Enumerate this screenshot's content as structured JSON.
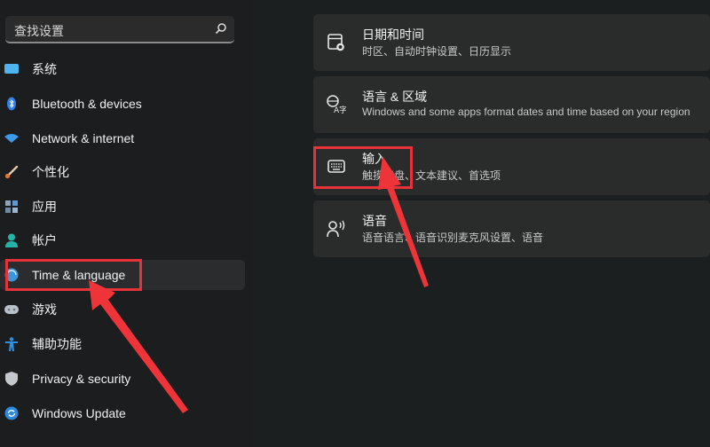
{
  "search": {
    "placeholder": "查找设置",
    "icon": "search-icon"
  },
  "sidebar": {
    "items": [
      {
        "label": "系统",
        "icon": "monitor-icon",
        "selected": false
      },
      {
        "label": "Bluetooth & devices",
        "icon": "bluetooth-icon",
        "selected": false
      },
      {
        "label": "Network & internet",
        "icon": "wifi-icon",
        "selected": false
      },
      {
        "label": "个性化",
        "icon": "paintbrush-icon",
        "selected": false
      },
      {
        "label": "应用",
        "icon": "apps-icon",
        "selected": false
      },
      {
        "label": "帐户",
        "icon": "person-icon",
        "selected": false
      },
      {
        "label": "Time & language",
        "icon": "globe-clock-icon",
        "selected": true
      },
      {
        "label": "游戏",
        "icon": "gamepad-icon",
        "selected": false
      },
      {
        "label": "辅助功能",
        "icon": "accessibility-icon",
        "selected": false
      },
      {
        "label": "Privacy & security",
        "icon": "shield-icon",
        "selected": false
      },
      {
        "label": "Windows Update",
        "icon": "update-icon",
        "selected": false
      }
    ]
  },
  "main": {
    "cards": [
      {
        "title": "日期和时间",
        "subtitle": "时区、自动时钟设置、日历显示",
        "icon": "calendar-clock-icon"
      },
      {
        "title": "语言 & 区域",
        "subtitle": "Windows and some apps format dates and time based on your region",
        "icon": "language-icon"
      },
      {
        "title": "输入",
        "subtitle": "触摸键盘、文本建议、首选项",
        "icon": "keyboard-icon"
      },
      {
        "title": "语音",
        "subtitle": "语音语言、语音识别麦克风设置、语音",
        "icon": "speech-icon"
      }
    ]
  },
  "annotations": {
    "color": "#e8323a",
    "highlighted": [
      "Time & language",
      "输入"
    ]
  }
}
